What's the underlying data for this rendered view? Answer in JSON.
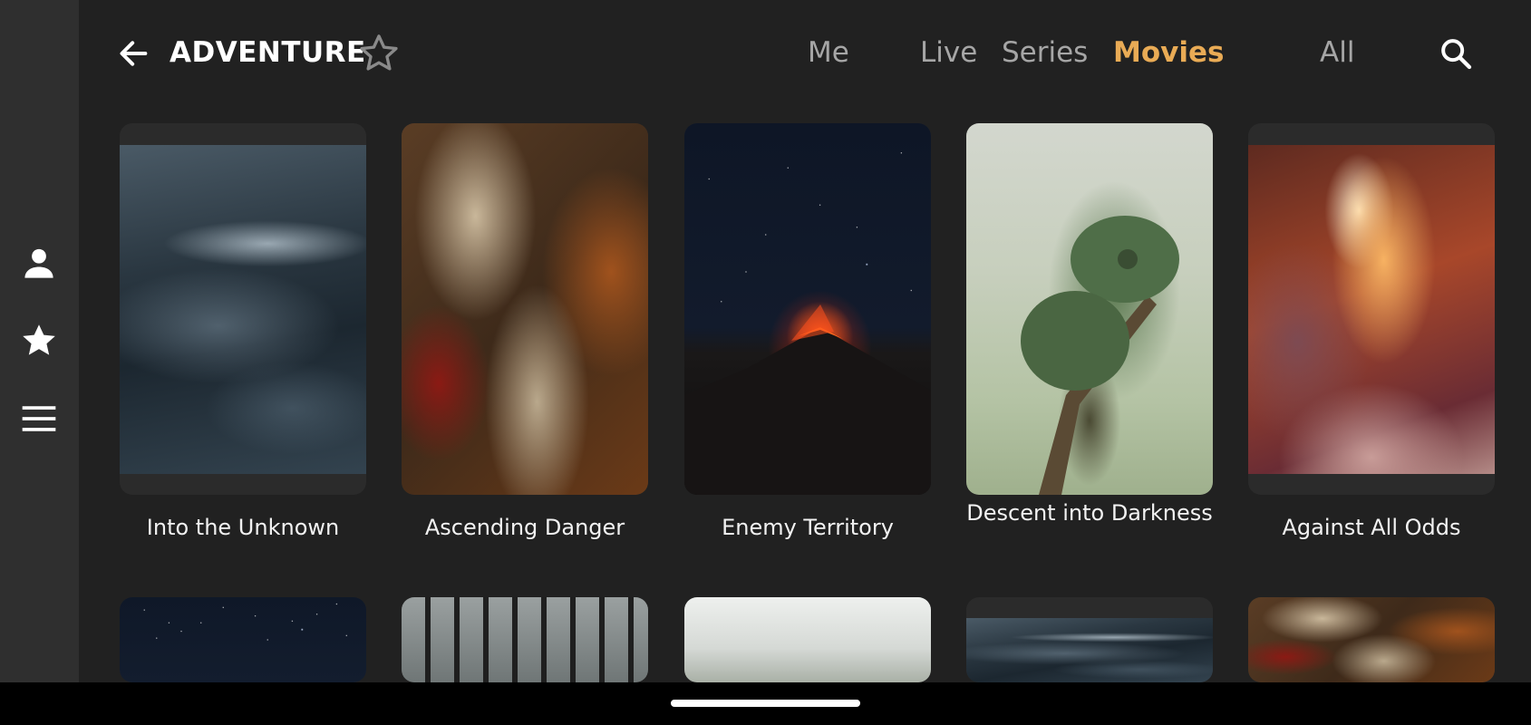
{
  "header": {
    "back_icon": "arrow-left-icon",
    "title": "ADVENTURE",
    "favorite_icon": "star-outline-icon",
    "search_icon": "search-icon",
    "tabs": [
      {
        "label": "Me",
        "active": false
      },
      {
        "label": "Live",
        "active": false
      },
      {
        "label": "Series",
        "active": false
      },
      {
        "label": "Movies",
        "active": true
      },
      {
        "label": "All",
        "active": false
      }
    ],
    "accent_color": "#e9ab55"
  },
  "sidebar": {
    "items": [
      {
        "icon": "person-icon"
      },
      {
        "icon": "star-icon"
      },
      {
        "icon": "menu-icon"
      }
    ]
  },
  "grid": {
    "row1": [
      {
        "title": "Into the Unknown",
        "art": "stormy ocean"
      },
      {
        "title": "Ascending Danger",
        "art": "armored knight with sword"
      },
      {
        "title": "Enemy Territory",
        "art": "erupting volcano at night"
      },
      {
        "title": "Descent into Darkness",
        "art": "chameleon on branch"
      },
      {
        "title": "Against All Odds",
        "art": "sandstone canyon"
      }
    ],
    "row2": [
      {
        "art": "starry night sky"
      },
      {
        "art": "iron gate"
      },
      {
        "art": "foggy forest"
      },
      {
        "art": "stormy ocean"
      },
      {
        "art": "armored knight with sword"
      }
    ]
  }
}
